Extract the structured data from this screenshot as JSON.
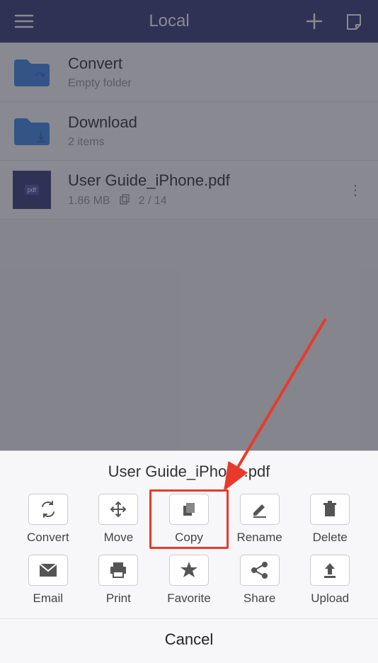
{
  "header": {
    "title": "Local"
  },
  "files": [
    {
      "name": "Convert",
      "meta": "Empty folder",
      "type": "folder-sync"
    },
    {
      "name": "Download",
      "meta": "2 items",
      "type": "folder-download"
    },
    {
      "name": "User Guide_iPhone.pdf",
      "size": "1.86 MB",
      "pages": "2 / 14",
      "type": "pdf"
    }
  ],
  "sheet": {
    "title": "User Guide_iPhone.pdf",
    "actions": [
      {
        "label": "Convert",
        "icon": "convert-icon"
      },
      {
        "label": "Move",
        "icon": "move-icon"
      },
      {
        "label": "Copy",
        "icon": "copy-icon"
      },
      {
        "label": "Rename",
        "icon": "rename-icon"
      },
      {
        "label": "Delete",
        "icon": "delete-icon"
      },
      {
        "label": "Email",
        "icon": "email-icon"
      },
      {
        "label": "Print",
        "icon": "print-icon"
      },
      {
        "label": "Favorite",
        "icon": "favorite-icon"
      },
      {
        "label": "Share",
        "icon": "share-icon"
      },
      {
        "label": "Upload",
        "icon": "upload-icon"
      }
    ],
    "cancel": "Cancel",
    "highlighted": "Copy"
  },
  "colors": {
    "brand": "#3b3f7a",
    "folder": "#3f8be8",
    "highlight": "#e83a2a"
  }
}
